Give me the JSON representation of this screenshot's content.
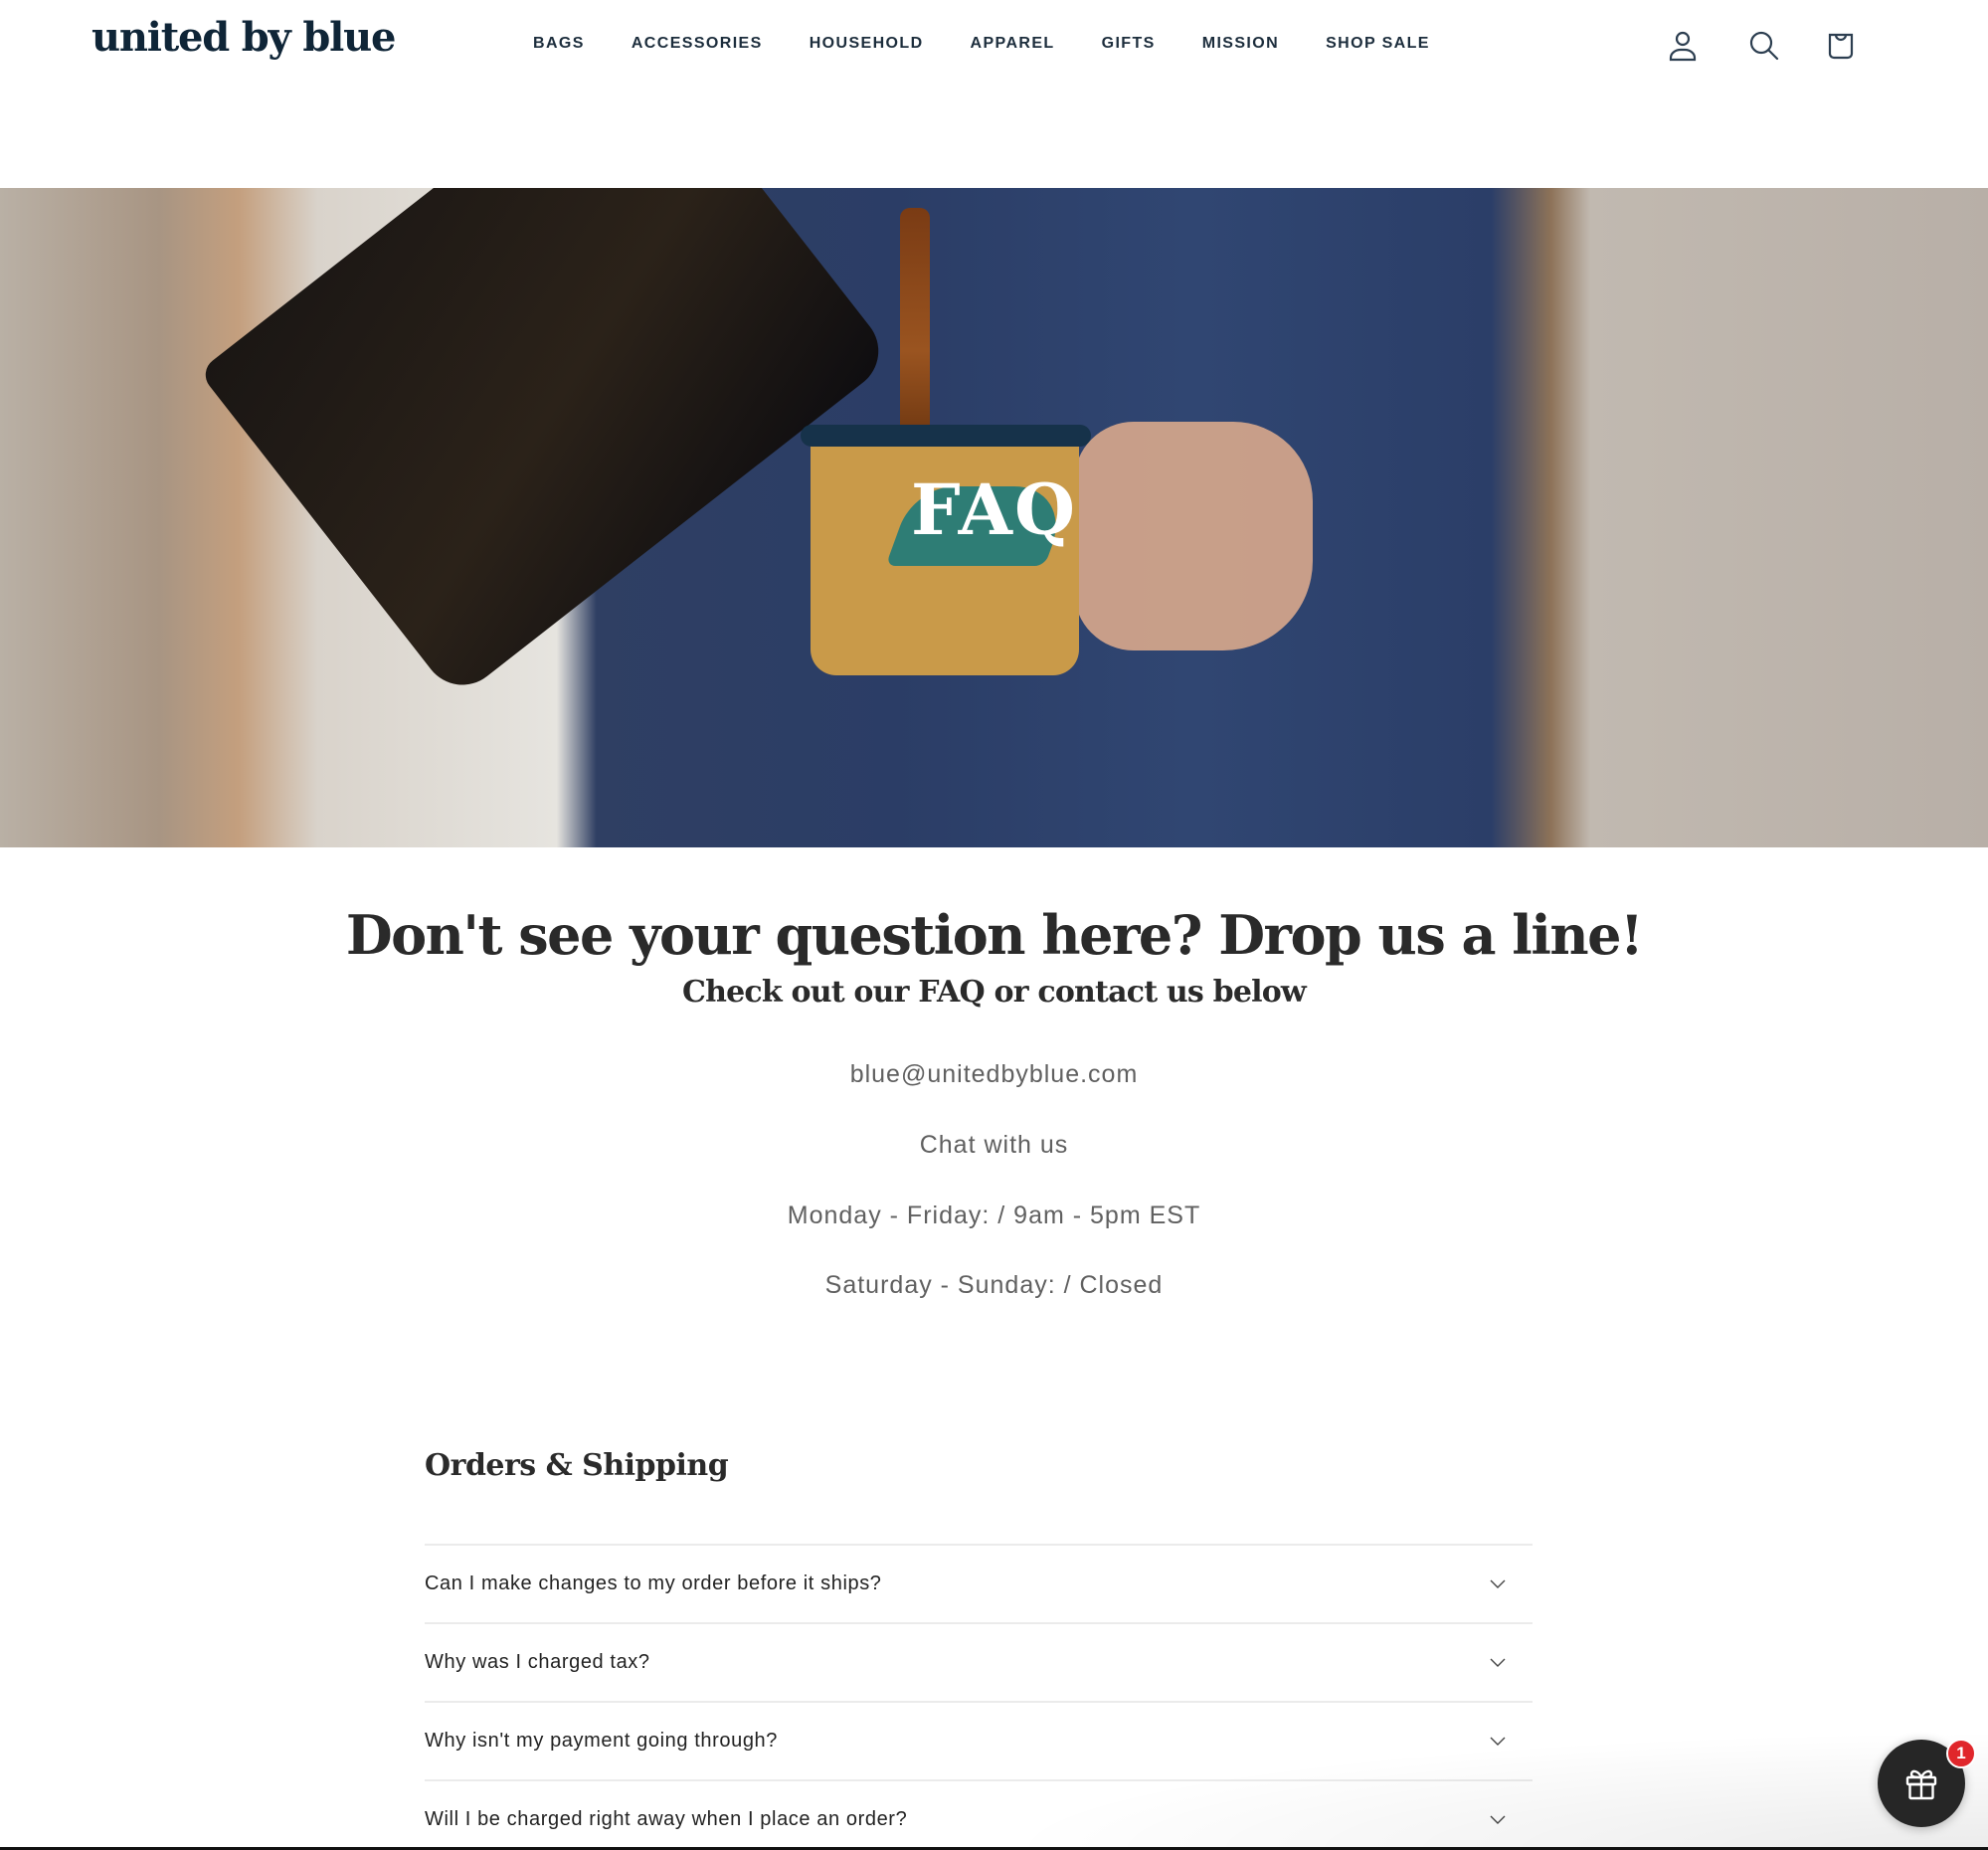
{
  "header": {
    "logo": "united by blue",
    "nav": [
      {
        "label": "BAGS"
      },
      {
        "label": "ACCESSORIES"
      },
      {
        "label": "HOUSEHOLD"
      },
      {
        "label": "APPAREL"
      },
      {
        "label": "GIFTS"
      },
      {
        "label": "MISSION"
      },
      {
        "label": "SHOP SALE"
      }
    ],
    "icons": {
      "account": "account-icon",
      "search": "search-icon",
      "cart": "cart-icon"
    }
  },
  "hero": {
    "title": "FAQ"
  },
  "contact": {
    "heading": "Don't see your question here? Drop us a line!",
    "subheading": "Check out our FAQ or contact us below",
    "email": "blue@unitedbyblue.com",
    "chat": "Chat with us",
    "weekday_hours": "Monday - Friday: / 9am - 5pm EST",
    "weekend_hours": "Saturday - Sunday: / Closed"
  },
  "faq": {
    "section_title": "Orders & Shipping",
    "items": [
      {
        "question": "Can I make changes to my order before it ships?"
      },
      {
        "question": "Why was I charged tax?"
      },
      {
        "question": "Why isn't my payment going through?"
      },
      {
        "question": "Will I be charged right away when I place an order?"
      }
    ]
  },
  "rewards_widget": {
    "icon": "gift-icon",
    "badge_count": "1"
  },
  "colors": {
    "brand_navy": "#0f2537",
    "text_dark": "#2a2a2a",
    "text_muted": "#606060",
    "divider": "#ebebeb",
    "badge_red": "#e0262b",
    "widget_bg": "#262626"
  }
}
